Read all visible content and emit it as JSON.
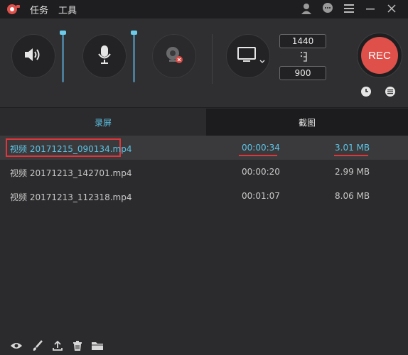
{
  "menu": {
    "task": "任务",
    "tools": "工具"
  },
  "resolution": {
    "width": "1440",
    "height": "900"
  },
  "rec_button": {
    "label": "REC"
  },
  "tabs": [
    {
      "label": "录屏"
    },
    {
      "label": "截图"
    }
  ],
  "files": [
    {
      "name": "视频 20171215_090134.mp4",
      "duration": "00:00:34",
      "size": "3.01 MB"
    },
    {
      "name": "视频 20171213_142701.mp4",
      "duration": "00:00:20",
      "size": "2.99 MB"
    },
    {
      "name": "视频 20171213_112318.mp4",
      "duration": "00:01:07",
      "size": "8.06 MB"
    }
  ],
  "colors": {
    "accent": "#5dc3e5",
    "rec": "#e0504a",
    "highlight": "#e0353a"
  },
  "icons": {
    "titlebar": [
      "user-icon",
      "chat-icon",
      "menu-icon",
      "minimize-icon",
      "close-icon"
    ],
    "controls": [
      "speaker-icon",
      "microphone-icon",
      "webcam-icon",
      "monitor-icon",
      "swap-icon",
      "clock-icon",
      "list-icon"
    ],
    "bottom": [
      "eye-icon",
      "brush-icon",
      "upload-icon",
      "trash-icon",
      "folder-icon"
    ]
  }
}
